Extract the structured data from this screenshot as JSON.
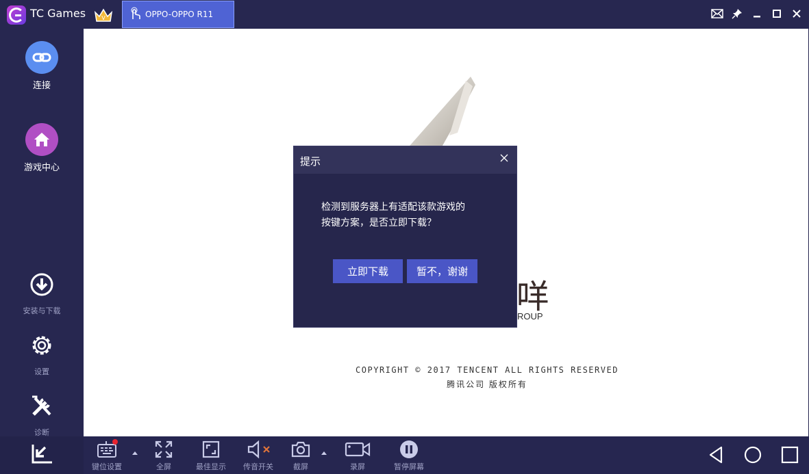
{
  "app": {
    "title": "TC Games"
  },
  "tab": {
    "label": "OPPO-OPPO R11"
  },
  "sidebar": {
    "items": [
      {
        "label": "连接"
      },
      {
        "label": "游戏中心"
      },
      {
        "label": "安装与下载"
      },
      {
        "label": "设置"
      },
      {
        "label": "诊断"
      }
    ]
  },
  "splash": {
    "brand_glyph": "咩",
    "brand_sub": "ROUP",
    "copyright": "COPYRIGHT © 2017 TENCENT ALL RIGHTS RESERVED",
    "copyright_cn": "腾讯公司 版权所有"
  },
  "dialog": {
    "title": "提示",
    "message_line1": "检测到服务器上有适配该款游戏的",
    "message_line2": "按键方案，是否立即下载？",
    "confirm_label": "立即下载",
    "decline_label": "暂不，谢谢"
  },
  "toolbar": {
    "items": [
      {
        "label": "键位设置"
      },
      {
        "label": "全屏"
      },
      {
        "label": "最佳显示"
      },
      {
        "label": "传音开关"
      },
      {
        "label": "截屏"
      },
      {
        "label": "录屏"
      },
      {
        "label": "暂停屏幕"
      }
    ]
  },
  "colors": {
    "background": "#272750",
    "accent": "#4a56c6",
    "tab_active": "#4f63d4",
    "connect_circle": "#5b8ef0",
    "game_center_circle": "#b04fc4",
    "notify_dot": "#e8232f"
  },
  "icons": {
    "connect": "link-icon",
    "game_center": "home-icon",
    "install": "download-icon",
    "settings": "gear-icon",
    "diagnose": "tools-icon"
  }
}
